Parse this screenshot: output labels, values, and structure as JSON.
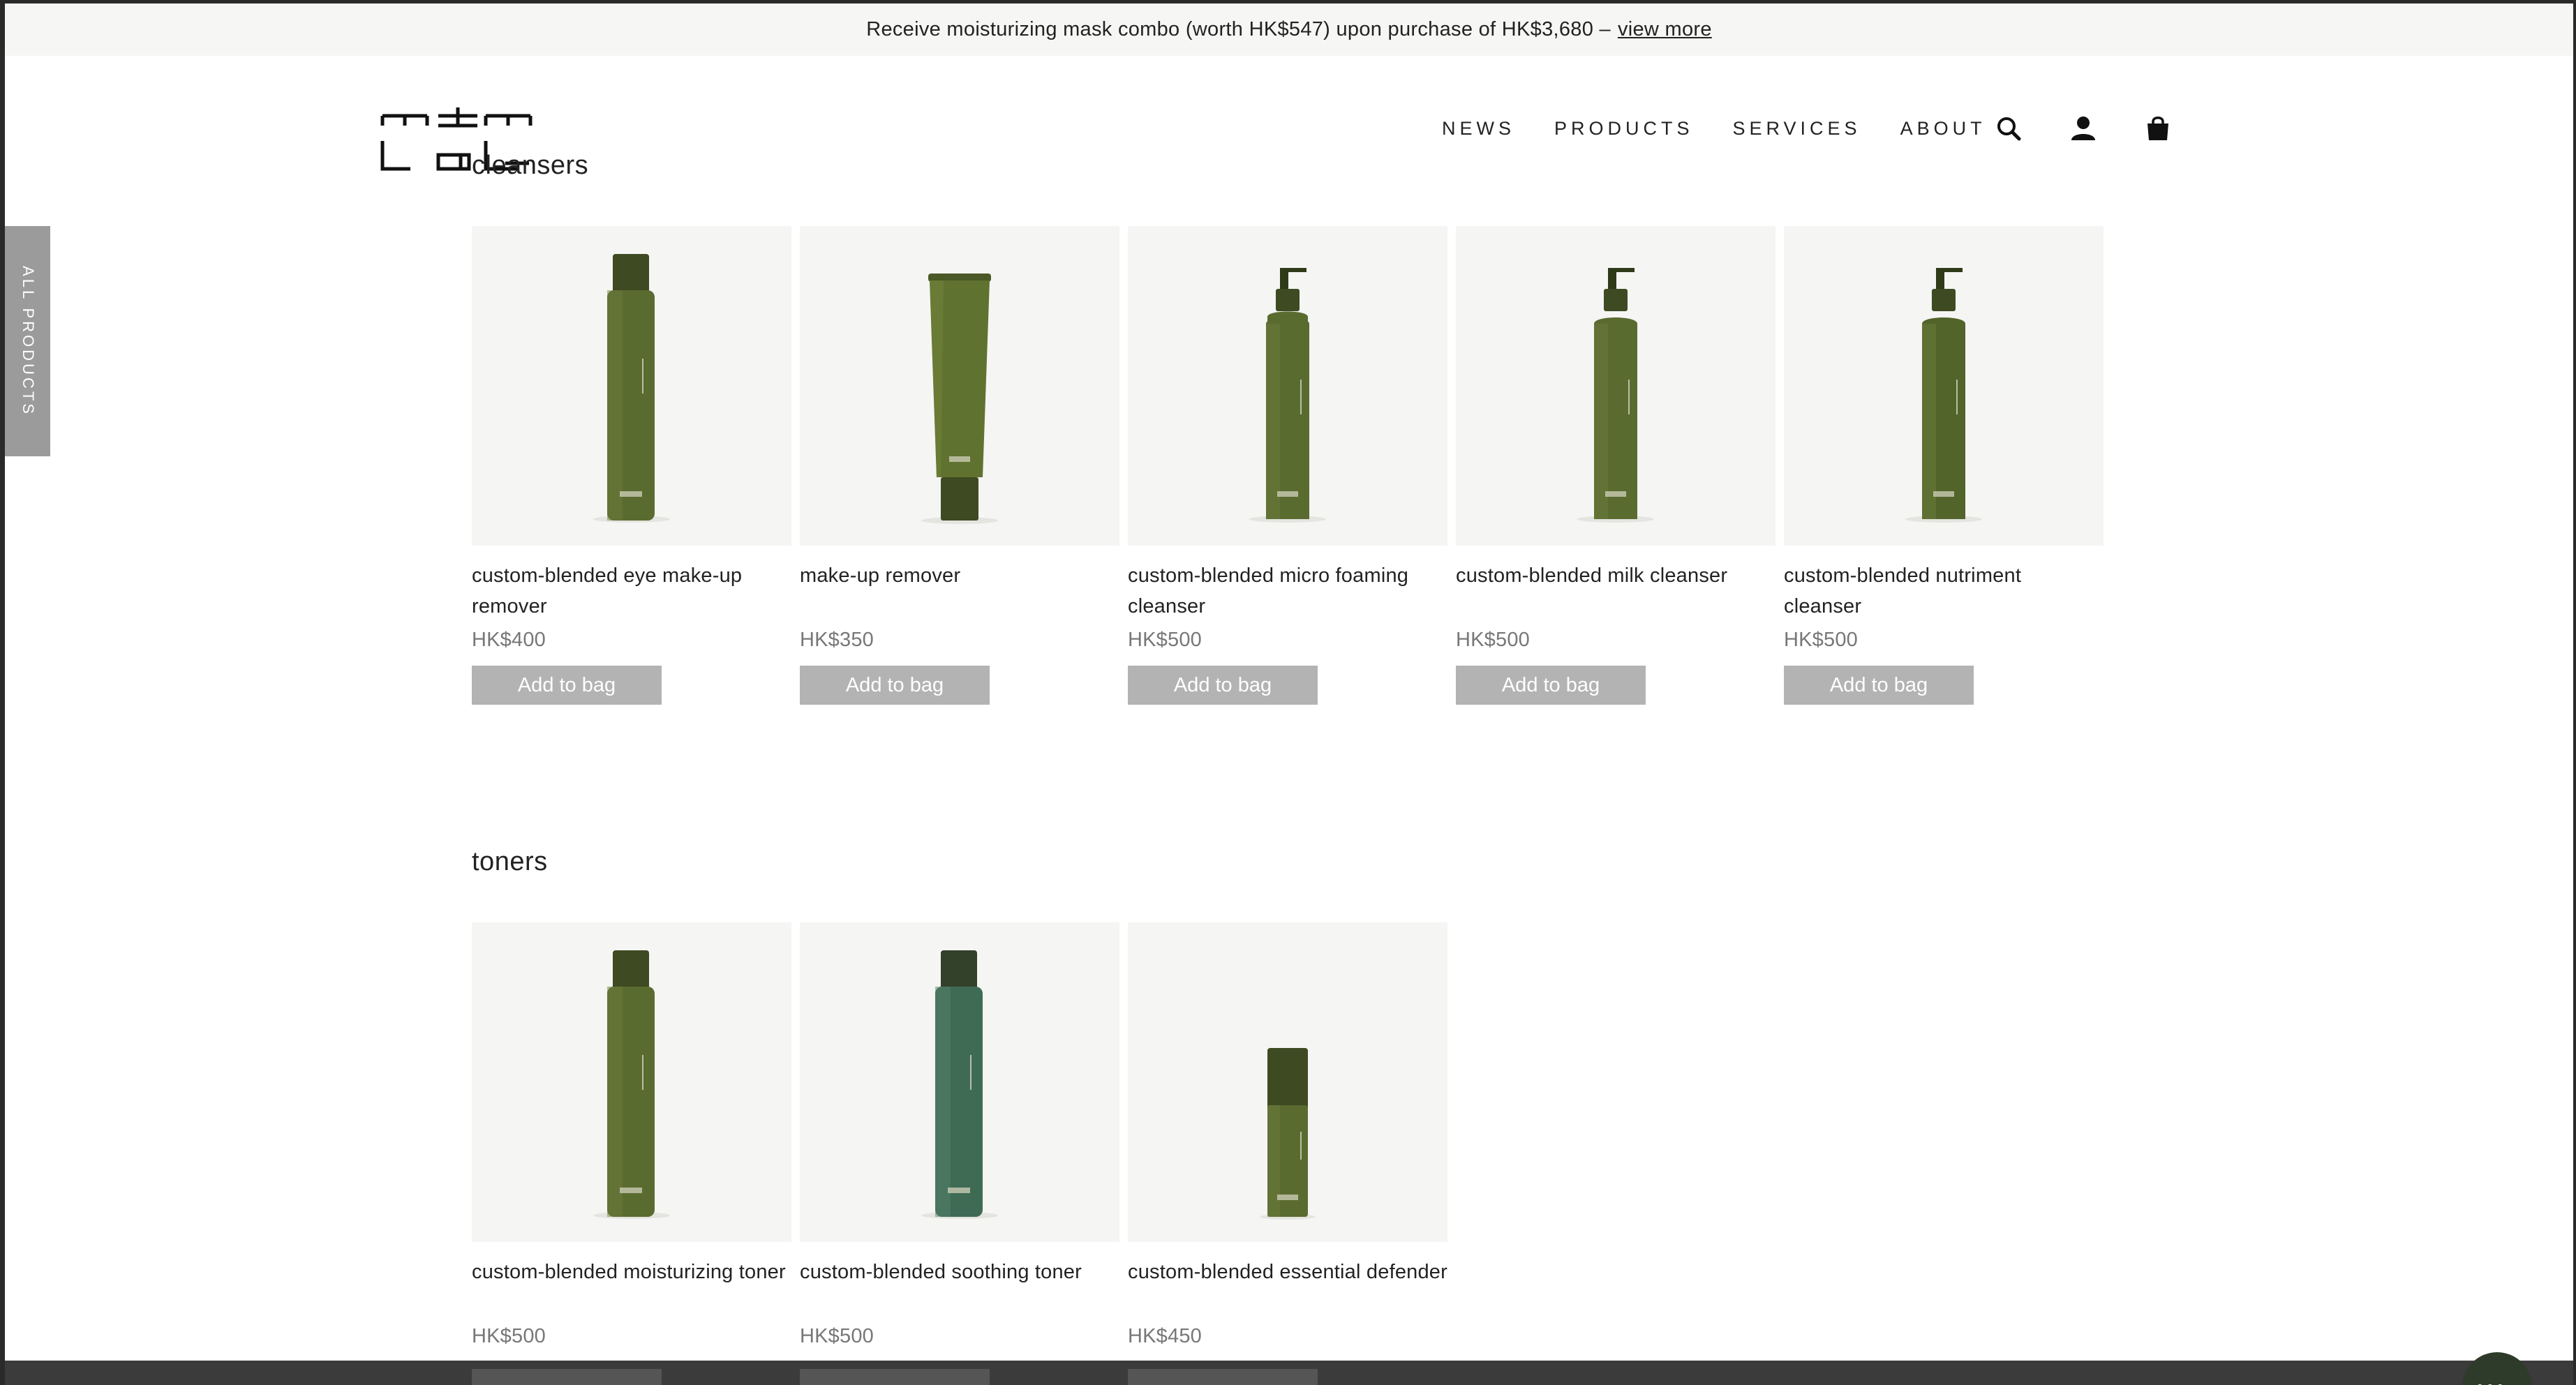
{
  "announcement": {
    "text": "Receive moisturizing mask combo (worth HK$547) upon purchase of HK$3,680 –",
    "link": "view more"
  },
  "nav": {
    "items": [
      "NEWS",
      "PRODUCTS",
      "SERVICES",
      "ABOUT"
    ],
    "icons": [
      "search-icon",
      "account-icon",
      "bag-icon"
    ]
  },
  "side_tab": {
    "label": "ALL PRODUCTS"
  },
  "sections": [
    {
      "title": "cleansers",
      "products": [
        {
          "name": "custom-blended eye make-up remover",
          "price": "HK$400",
          "button": "Add to bag"
        },
        {
          "name": "make-up remover",
          "price": "HK$350",
          "button": "Add to bag"
        },
        {
          "name": "custom-blended micro foaming cleanser",
          "price": "HK$500",
          "button": "Add to bag"
        },
        {
          "name": "custom-blended milk cleanser",
          "price": "HK$500",
          "button": "Add to bag"
        },
        {
          "name": "custom-blended nutriment cleanser",
          "price": "HK$500",
          "button": "Add to bag"
        }
      ]
    },
    {
      "title": "toners",
      "products": [
        {
          "name": "custom-blended moisturizing toner",
          "price": "HK$500"
        },
        {
          "name": "custom-blended soothing toner",
          "price": "HK$500"
        },
        {
          "name": "custom-blended essential defender",
          "price": "HK$450"
        }
      ]
    }
  ],
  "colors": {
    "bottle_olive": "#556b2f",
    "bottle_teal": "#3f6b55",
    "card_bg": "#f5f5f3",
    "button_bg": "#b3b3b3"
  }
}
